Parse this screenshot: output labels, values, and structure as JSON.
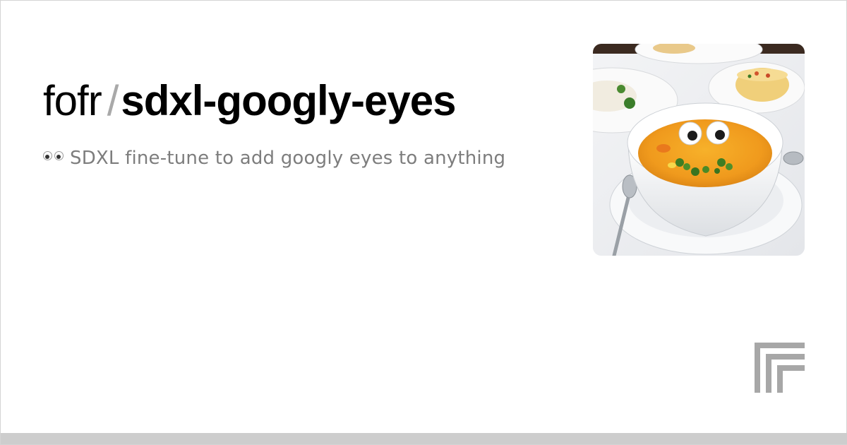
{
  "header": {
    "owner": "fofr",
    "separator": "/",
    "model_name": "sdxl-googly-eyes"
  },
  "description": {
    "text": "SDXL fine-tune to add googly eyes to anything",
    "emoji_icon": "eyes-emoji-icon"
  },
  "cover_image": {
    "subject": "soup bowl with googly eyes",
    "icon": "cover-image"
  },
  "brand": {
    "logo_icon": "replicate-logo-icon",
    "logo_color": "#a7a7a7"
  },
  "colors": {
    "title": "#000000",
    "separator": "#a9a9a9",
    "description": "#7d7d7d",
    "bottom_bar": "#cdcdcd",
    "border": "#d4d4d4"
  }
}
